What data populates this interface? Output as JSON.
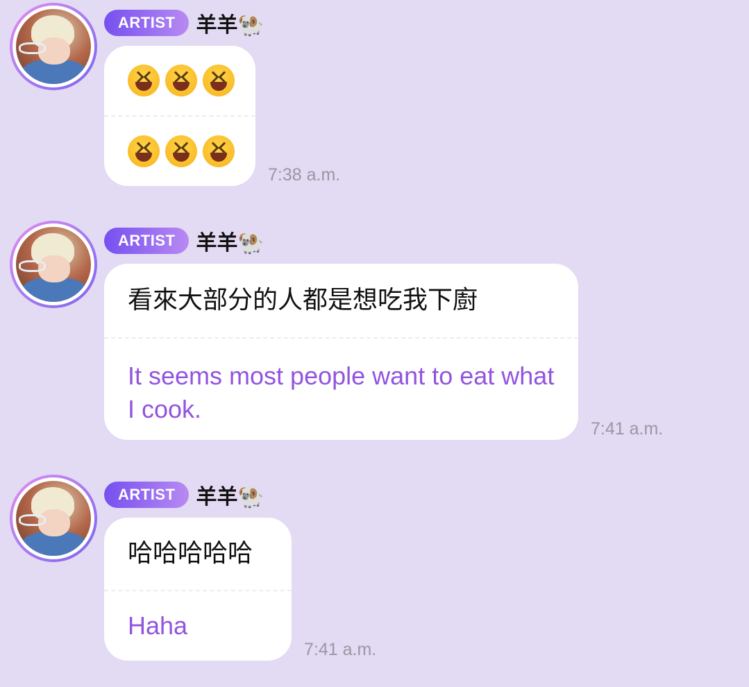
{
  "messages": [
    {
      "badge": "ARTIST",
      "name": "羊羊🐏",
      "original": "😆😆😆",
      "translation": "😆😆😆",
      "time": "7:38 a.m."
    },
    {
      "badge": "ARTIST",
      "name": "羊羊🐏",
      "original": "看來大部分的人都是想吃我下廚",
      "translation": "It seems most people want to eat what I cook.",
      "time": "7:41 a.m."
    },
    {
      "badge": "ARTIST",
      "name": "羊羊🐏",
      "original": "哈哈哈哈哈",
      "translation": "Haha",
      "time": "7:41 a.m."
    }
  ],
  "colors": {
    "background": "#e3daf3",
    "translation_text": "#9254de",
    "badge_start": "#7650f0",
    "badge_end": "#b88af2"
  },
  "icons": {
    "emoji": "grinning-squinting-face-icon",
    "name_emoji": "ram-icon"
  }
}
